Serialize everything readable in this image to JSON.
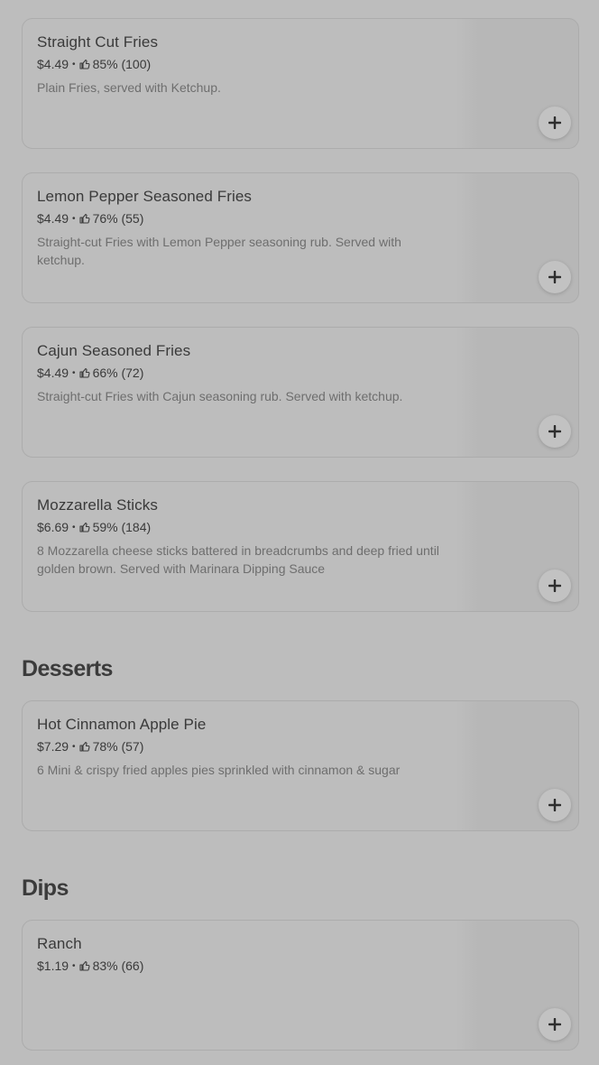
{
  "sections": [
    {
      "title": "",
      "items": [
        {
          "name": "Straight Cut Fries",
          "price": "$4.49",
          "rating": "85% (100)",
          "description": "Plain Fries, served with Ketchup."
        },
        {
          "name": "Lemon Pepper Seasoned Fries",
          "price": "$4.49",
          "rating": "76% (55)",
          "description": "Straight-cut Fries with Lemon Pepper seasoning rub. Served with ketchup."
        },
        {
          "name": "Cajun Seasoned Fries",
          "price": "$4.49",
          "rating": "66% (72)",
          "description": "Straight-cut Fries with Cajun seasoning rub. Served with ketchup."
        },
        {
          "name": "Mozzarella Sticks",
          "price": "$6.69",
          "rating": "59% (184)",
          "description": "8 Mozzarella cheese sticks battered in breadcrumbs and deep fried until golden brown. Served with Marinara Dipping Sauce"
        }
      ]
    },
    {
      "title": "Desserts",
      "items": [
        {
          "name": "Hot Cinnamon Apple Pie",
          "price": "$7.29",
          "rating": "78% (57)",
          "description": "6 Mini & crispy fried apples pies sprinkled with cinnamon & sugar"
        }
      ]
    },
    {
      "title": "Dips",
      "items": [
        {
          "name": "Ranch",
          "price": "$1.19",
          "rating": "83% (66)",
          "description": ""
        }
      ]
    }
  ],
  "meta_separator": "•",
  "icons": {
    "rating": "thumbs-up-icon",
    "add": "plus-icon"
  }
}
